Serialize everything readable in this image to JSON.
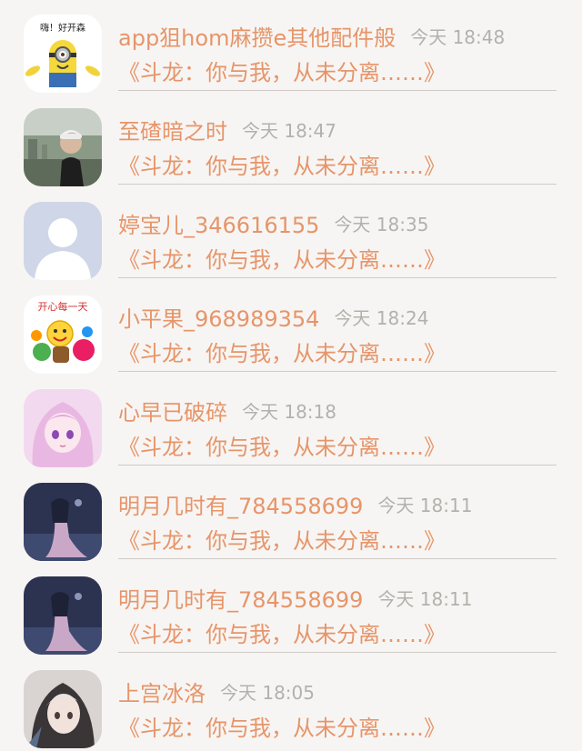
{
  "items": [
    {
      "name": "app狙hom麻攒e其他配件般",
      "time": "今天 18:48",
      "message": "《斗龙：你与我，从未分离……》",
      "avatar_text": "嗨！好开森",
      "avatar_icon": "minion-avatar-icon"
    },
    {
      "name": "至碴暗之时",
      "time": "今天 18:47",
      "message": "《斗龙：你与我，从未分离……》",
      "avatar_icon": "person-photo-avatar-icon"
    },
    {
      "name": "婷宝儿_346616155",
      "time": "今天 18:35",
      "message": "《斗龙：你与我，从未分离……》",
      "avatar_icon": "default-user-avatar-icon"
    },
    {
      "name": "小平果_968989354",
      "time": "今天 18:24",
      "message": "《斗龙：你与我，从未分离……》",
      "avatar_text": "开心每一天",
      "avatar_icon": "smiley-avatar-icon"
    },
    {
      "name": "心早已破碎",
      "time": "今天 18:18",
      "message": "《斗龙：你与我，从未分离……》",
      "avatar_icon": "anime-girl-avatar-icon"
    },
    {
      "name": "明月几时有_784558699",
      "time": "今天 18:11",
      "message": "《斗龙：你与我，从未分离……》",
      "avatar_icon": "night-figure-avatar-icon"
    },
    {
      "name": "明月几时有_784558699",
      "time": "今天 18:11",
      "message": "《斗龙：你与我，从未分离……》",
      "avatar_icon": "night-figure-avatar-icon"
    },
    {
      "name": "上宫冰洛",
      "time": "今天 18:05",
      "message": "《斗龙：你与我，从未分离……》",
      "avatar_icon": "anime-character-avatar-icon"
    }
  ],
  "colors": {
    "accent": "#e6956a",
    "time": "#b4b0ac",
    "background": "#f7f5f3",
    "divider": "#cfcac6"
  }
}
